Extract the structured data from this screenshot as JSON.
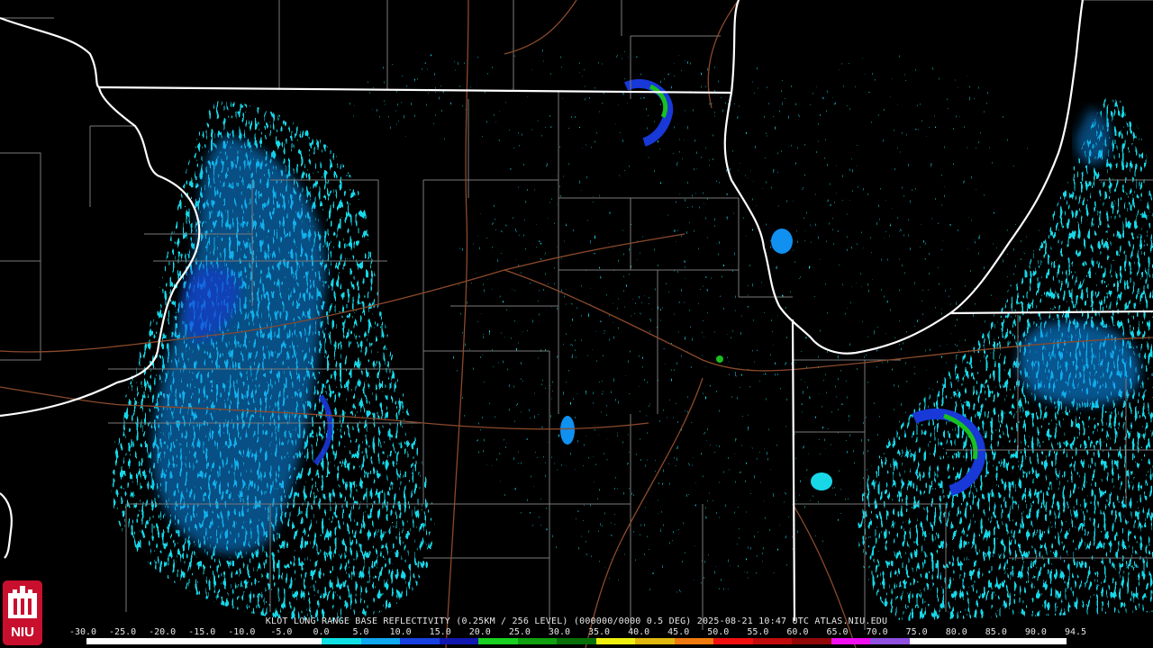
{
  "title": "KLOT LONG RANGE BASE REFLECTIVITY (0.25KM / 256 LEVEL) (000000/0000 0.5 DEG) 2025-08-21 10:47 UTC  ATLAS.NIU.EDU",
  "logo": {
    "text": "NIU",
    "icon": "niu-logo-icon",
    "color": "#c8102e"
  },
  "scale": {
    "labels": [
      "-30.0",
      "-25.0",
      "-20.0",
      "-15.0",
      "-10.0",
      "-5.0",
      "0.0",
      "5.0",
      "10.0",
      "15.0",
      "20.0",
      "25.0",
      "30.0",
      "35.0",
      "40.0",
      "45.0",
      "50.0",
      "55.0",
      "60.0",
      "65.0",
      "70.0",
      "75.0",
      "80.0",
      "85.0",
      "90.0",
      "94.5"
    ],
    "colors": [
      "#ffffff",
      "#ffffff",
      "#ffffff",
      "#ffffff",
      "#ffffff",
      "#ffffff",
      "#0fe0e6",
      "#10a8f0",
      "#1840e0",
      "#1018b0",
      "#18d020",
      "#10a010",
      "#087008",
      "#f0f010",
      "#e0b810",
      "#f07a10",
      "#f01010",
      "#c00c0c",
      "#900808",
      "#f010f0",
      "#9050e0",
      "#ffffff",
      "#ffffff",
      "#ffffff",
      "#ffffff"
    ]
  },
  "colors": {
    "background": "#000000",
    "state_border": "#ffffff",
    "county_border": "#7a7a7a",
    "highway": "#8b4a2b",
    "echo_light": "#18d8e8",
    "echo_mid": "#1090f0",
    "echo_strong": "#1838d8",
    "echo_green": "#18c020"
  }
}
